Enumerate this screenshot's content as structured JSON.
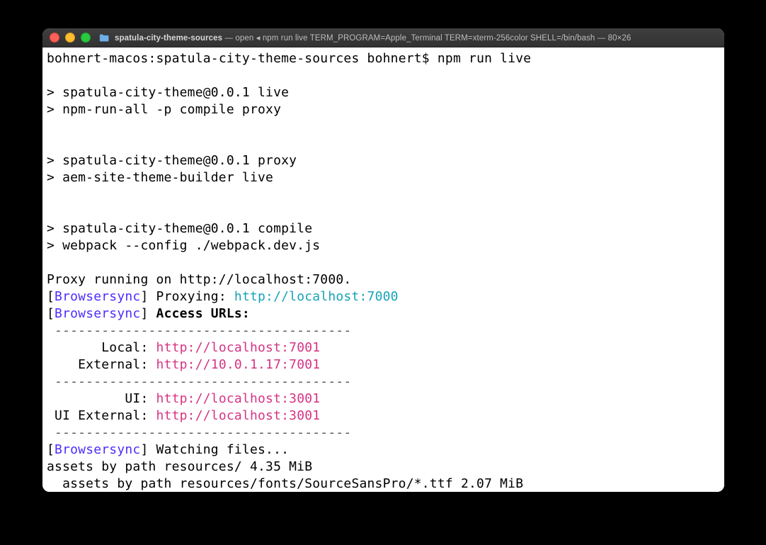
{
  "titlebar": {
    "folder_name": "spatula-city-theme-sources",
    "process": "open",
    "command": "npm run live TERM_PROGRAM=Apple_Terminal TERM=xterm-256color SHELL=/bin/bash",
    "dims": "80×26"
  },
  "term": {
    "prompt_host": "bohnert-macos:",
    "prompt_dir": "spatula-city-theme-sources",
    "prompt_user": "bohnert$",
    "cmd": "npm run live",
    "l1": "> spatula-city-theme@0.0.1 live",
    "l2": "> npm-run-all -p compile proxy",
    "l3": "> spatula-city-theme@0.0.1 proxy",
    "l4": "> aem-site-theme-builder live",
    "l5": "> spatula-city-theme@0.0.1 compile",
    "l6": "> webpack --config ./webpack.dev.js",
    "proxy_line": "Proxy running on http://localhost:7000.",
    "bs": "Browsersync",
    "proxying_label": "] Proxying: ",
    "proxying_url": "http://localhost:7000",
    "access_label": "Access URLs:",
    "rule": " --------------------------------------",
    "local_label": "       Local: ",
    "local_url": "http://localhost:7001",
    "external_label": "    External: ",
    "external_url": "http://10.0.1.17:7001",
    "ui_label": "          UI: ",
    "ui_url": "http://localhost:3001",
    "uiext_label": " UI External: ",
    "uiext_url": "http://localhost:3001",
    "watching": "] Watching files...",
    "assets1": "assets by path resources/ 4.35 MiB",
    "assets2": "  assets by path resources/fonts/SourceSansPro/*.ttf 2.07 MiB"
  }
}
